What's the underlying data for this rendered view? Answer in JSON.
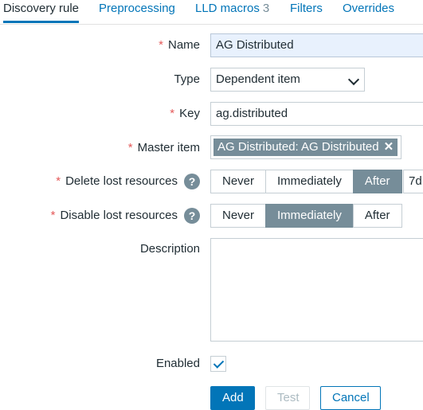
{
  "tabs": [
    {
      "label": "Discovery rule"
    },
    {
      "label": "Preprocessing"
    },
    {
      "label": "LLD macros",
      "count": "3"
    },
    {
      "label": "Filters"
    },
    {
      "label": "Overrides"
    }
  ],
  "form": {
    "name": {
      "label": "Name",
      "value": "AG Distributed"
    },
    "type": {
      "label": "Type",
      "selected": "Dependent item"
    },
    "key": {
      "label": "Key",
      "value": "ag.distributed"
    },
    "master_item": {
      "label": "Master item",
      "pill": "AG Distributed: AG Distributed"
    },
    "delete_lost": {
      "label": "Delete lost resources",
      "options": [
        "Never",
        "Immediately",
        "After"
      ],
      "selected": "After",
      "period": "7d"
    },
    "disable_lost": {
      "label": "Disable lost resources",
      "options": [
        "Never",
        "Immediately",
        "After"
      ],
      "selected": "Immediately"
    },
    "description": {
      "label": "Description",
      "value": ""
    },
    "enabled": {
      "label": "Enabled",
      "checked": true
    },
    "help_glyph": "?",
    "required_mark": "*"
  },
  "buttons": {
    "add": "Add",
    "test": "Test",
    "cancel": "Cancel"
  },
  "colors": {
    "accent": "#0275b8",
    "selected_segment": "#768d99",
    "required": "#e45959"
  }
}
